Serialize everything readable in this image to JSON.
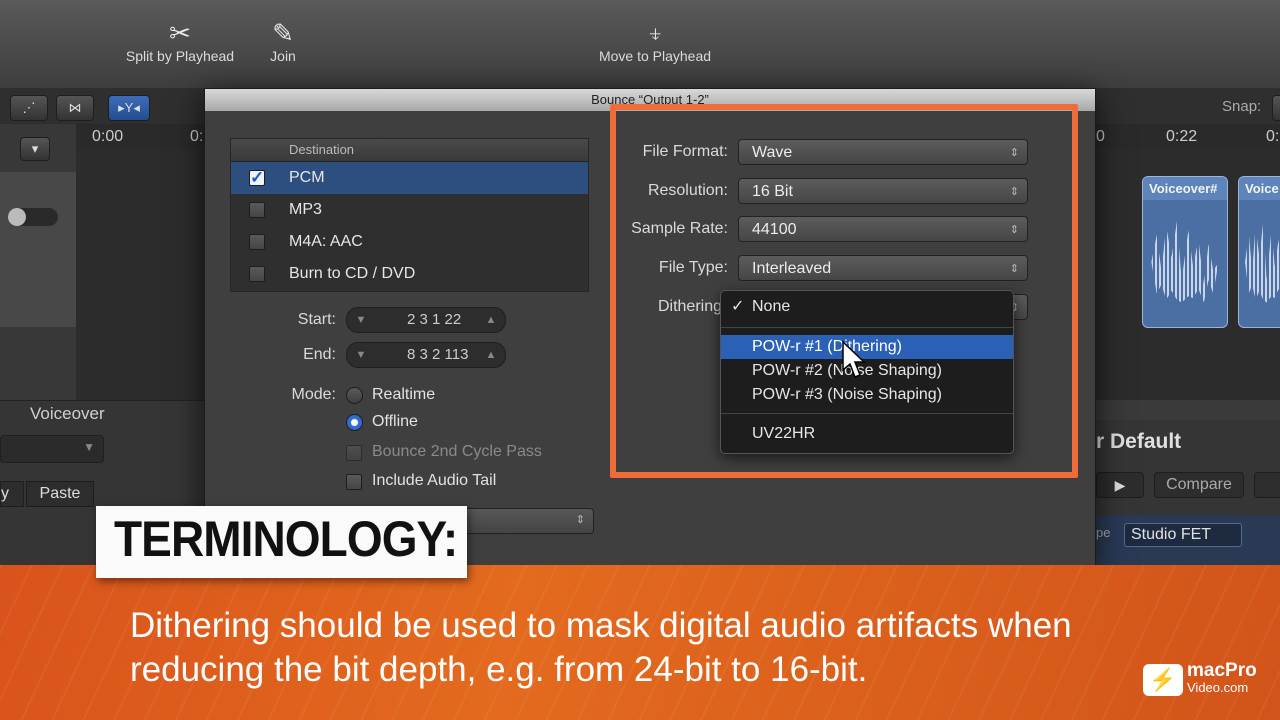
{
  "toolbar": {
    "split_label": "Split by Playhead",
    "join_label": "Join",
    "move_label": "Move to Playhead",
    "split_icon": "scissors-icon",
    "join_icon": "glue-icon",
    "move_icon": "playhead-icon"
  },
  "subbar": {
    "snap_label": "Snap:"
  },
  "ruler": {
    "marks": [
      "0:00",
      "0:",
      "0",
      "0:22",
      "0:"
    ]
  },
  "regions": [
    "Voiceover#",
    "Voice"
  ],
  "left_panel": {
    "track_label": "Voiceover",
    "paste_label": "Paste",
    "copy_label": "y"
  },
  "right_panel": {
    "preset_label": "r Default",
    "compare_label": "Compare",
    "type_label": "pe",
    "mic_value": "Studio FET"
  },
  "dialog": {
    "title": "Bounce “Output 1-2”",
    "destination_header": "Destination",
    "destinations": [
      {
        "label": "PCM",
        "checked": true
      },
      {
        "label": "MP3",
        "checked": false
      },
      {
        "label": "M4A: AAC",
        "checked": false
      },
      {
        "label": "Burn to CD / DVD",
        "checked": false
      }
    ],
    "start_label": "Start:",
    "start_value": "2 3 1   22",
    "end_label": "End:",
    "end_value": "8 3 2 113",
    "mode_label": "Mode:",
    "mode_realtime": "Realtime",
    "mode_offline": "Offline",
    "bounce_2nd": "Bounce 2nd Cycle Pass",
    "include_tail": "Include Audio Tail",
    "file_format_label": "File Format:",
    "file_format_value": "Wave",
    "resolution_label": "Resolution:",
    "resolution_value": "16 Bit",
    "sample_rate_label": "Sample Rate:",
    "sample_rate_value": "44100",
    "file_type_label": "File Type:",
    "file_type_value": "Interleaved",
    "dithering_label": "Dithering",
    "dither_menu": {
      "none": "None",
      "check": "✓",
      "pow1": "POW-r #1 (Dithering)",
      "pow2": "POW-r #2 (Noise Shaping)",
      "pow3": "POW-r #3 (Noise Shaping)",
      "uv22": "UV22HR"
    }
  },
  "overlay": {
    "term_title": "TERMINOLOGY:",
    "caption": "Dithering should be used to mask digital audio artifacts when reducing the bit depth, e.g. from 24-bit to 16-bit.",
    "logo_main": "macPro",
    "logo_sub": "Video.com"
  },
  "colors": {
    "highlight_border": "#ef6c3a",
    "banner_orange": "#e0601d",
    "menu_selection": "#2a61b6"
  }
}
